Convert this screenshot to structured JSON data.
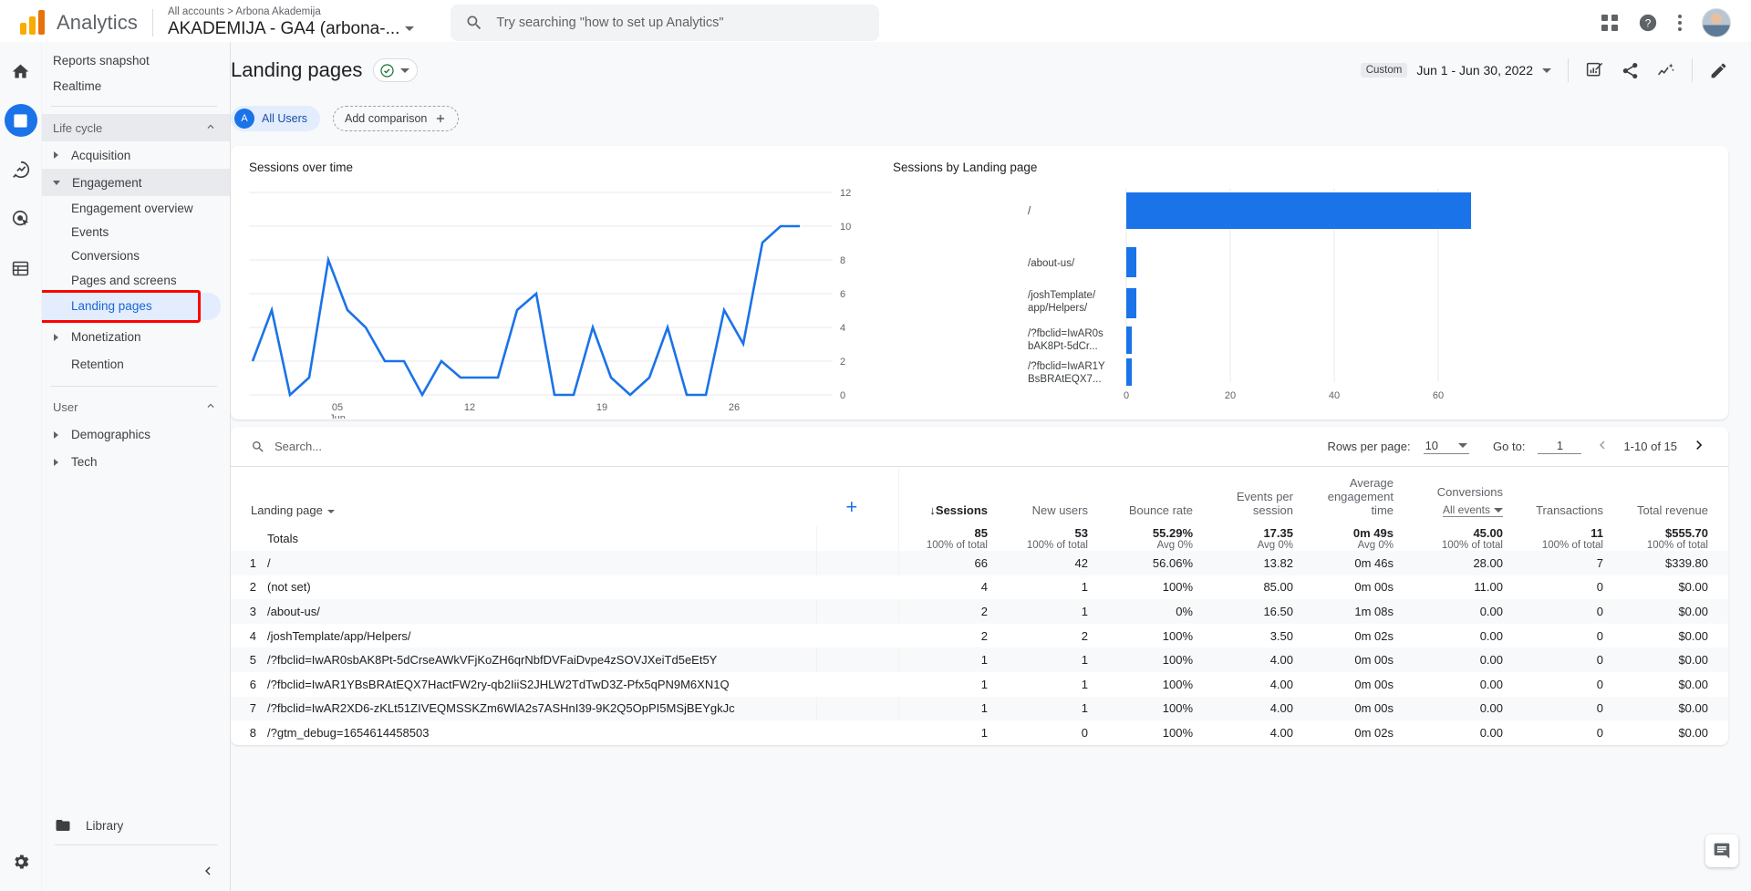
{
  "topbar": {
    "brand": "Analytics",
    "breadcrumb": "All accounts  >  Arbona Akademija",
    "property": "AKADEMIJA - GA4 (arbona-...",
    "search_placeholder": "Try searching \"how to set up Analytics\"",
    "apps_icon": "apps-grid-icon",
    "help_icon": "help-icon",
    "more_icon": "kebab-menu-icon",
    "avatar": "user-avatar"
  },
  "rail": {
    "items": [
      {
        "name": "home-icon",
        "label": "Home"
      },
      {
        "name": "reports-icon",
        "label": "Reports"
      },
      {
        "name": "explore-icon",
        "label": "Explore"
      },
      {
        "name": "advertising-icon",
        "label": "Advertising"
      },
      {
        "name": "configure-icon",
        "label": "Configure"
      }
    ],
    "settings": "settings-gear-icon"
  },
  "sidebar": {
    "top_items": [
      {
        "label": "Reports snapshot"
      },
      {
        "label": "Realtime"
      }
    ],
    "groups": [
      {
        "title": "Life cycle",
        "items": [
          {
            "label": "Acquisition",
            "expanded": false
          },
          {
            "label": "Engagement",
            "expanded": true,
            "children": [
              "Engagement overview",
              "Events",
              "Conversions",
              "Pages and screens",
              "Landing pages"
            ]
          },
          {
            "label": "Monetization",
            "expanded": false
          },
          {
            "label": "Retention",
            "expanded": null
          }
        ]
      },
      {
        "title": "User",
        "items": [
          {
            "label": "Demographics",
            "expanded": false
          },
          {
            "label": "Tech",
            "expanded": false
          }
        ]
      }
    ],
    "selected": "Landing pages",
    "library": "Library",
    "collapse_icon": "chevron-left-icon"
  },
  "page": {
    "title": "Landing pages",
    "status_icon": "check-circle-icon",
    "status_color": "#137333",
    "date_tag": "Custom",
    "date_range": "Jun 1 - Jun 30, 2022",
    "actions": [
      {
        "name": "insights-icon",
        "label": "Insights"
      },
      {
        "name": "share-icon",
        "label": "Share this report"
      },
      {
        "name": "compare-icon",
        "label": "Comparison"
      },
      {
        "name": "edit-icon",
        "label": "Edit"
      }
    ],
    "chips": {
      "all_users_initial": "A",
      "all_users": "All Users",
      "add_comparison": "Add comparison"
    }
  },
  "chart_data": [
    {
      "type": "line",
      "title": "Sessions over time",
      "xlabel": "",
      "ylabel": "",
      "ylim": [
        0,
        12
      ],
      "yticks": [
        0,
        2,
        4,
        6,
        8,
        10,
        12
      ],
      "xticks": [
        "05",
        "12",
        "19",
        "26"
      ],
      "xtick_sublabel": "Jun",
      "grid": true,
      "legend": "none",
      "series_color": "#1a73e8",
      "x": [
        "Jun 1",
        "Jun 2",
        "Jun 3",
        "Jun 4",
        "Jun 5",
        "Jun 6",
        "Jun 7",
        "Jun 8",
        "Jun 9",
        "Jun 10",
        "Jun 11",
        "Jun 12",
        "Jun 13",
        "Jun 14",
        "Jun 15",
        "Jun 16",
        "Jun 17",
        "Jun 18",
        "Jun 19",
        "Jun 20",
        "Jun 21",
        "Jun 22",
        "Jun 23",
        "Jun 24",
        "Jun 25",
        "Jun 26",
        "Jun 27",
        "Jun 28",
        "Jun 29",
        "Jun 30"
      ],
      "values": [
        2,
        5,
        0,
        1,
        8,
        5,
        4,
        2,
        2,
        0,
        2,
        1,
        1,
        1,
        5,
        6,
        0,
        0,
        4,
        1,
        0,
        1,
        4,
        0,
        0,
        5,
        3,
        9,
        10,
        10
      ]
    },
    {
      "type": "bar",
      "orientation": "horizontal",
      "title": "Sessions by Landing page",
      "xlim": [
        0,
        66
      ],
      "xticks": [
        0,
        20,
        40,
        60
      ],
      "grid": true,
      "bar_color": "#1a73e8",
      "categories": [
        "/",
        "/about-us/",
        "/joshTemplate/\napp/Helpers/",
        "/?fbclid=IwAR0s\nbAK8Pt-5dCr...",
        "/?fbclid=IwAR1Y\nBsBRAtEQX7..."
      ],
      "values": [
        66,
        2,
        2,
        1,
        1
      ]
    }
  ],
  "table": {
    "search_placeholder": "Search...",
    "pagination": {
      "rows_label": "Rows per page:",
      "rows_value": "10",
      "goto_label": "Go to:",
      "goto_value": "1",
      "range": "1-10 of 15",
      "prev_icon": "chevron-left-icon",
      "next_icon": "chevron-right-icon"
    },
    "dimension_header": "Landing page",
    "add_dimension_icon": "plus-icon",
    "columns": [
      {
        "label": "Sessions",
        "sorted": true,
        "sort_icon": "arrow-down"
      },
      {
        "label": "New users"
      },
      {
        "label": "Bounce rate"
      },
      {
        "label": "Events per session"
      },
      {
        "label": "Average engagement time"
      },
      {
        "label": "Conversions",
        "sub": "All events"
      },
      {
        "label": "Transactions"
      },
      {
        "label": "Total revenue"
      }
    ],
    "totals": {
      "label": "Totals",
      "values": [
        "85",
        "53",
        "55.29%",
        "17.35",
        "0m 49s",
        "45.00",
        "11",
        "$555.70"
      ],
      "subs": [
        "100% of total",
        "100% of total",
        "Avg 0%",
        "Avg 0%",
        "Avg 0%",
        "100% of total",
        "100% of total",
        "100% of total"
      ]
    },
    "rows": [
      {
        "idx": "1",
        "dim": "/",
        "vals": [
          "66",
          "42",
          "56.06%",
          "13.82",
          "0m 46s",
          "28.00",
          "7",
          "$339.80"
        ]
      },
      {
        "idx": "2",
        "dim": "(not set)",
        "vals": [
          "4",
          "1",
          "100%",
          "85.00",
          "0m 00s",
          "11.00",
          "0",
          "$0.00"
        ]
      },
      {
        "idx": "3",
        "dim": "/about-us/",
        "vals": [
          "2",
          "1",
          "0%",
          "16.50",
          "1m 08s",
          "0.00",
          "0",
          "$0.00"
        ]
      },
      {
        "idx": "4",
        "dim": "/joshTemplate/app/Helpers/",
        "vals": [
          "2",
          "2",
          "100%",
          "3.50",
          "0m 02s",
          "0.00",
          "0",
          "$0.00"
        ]
      },
      {
        "idx": "5",
        "dim": "/?fbclid=IwAR0sbAK8Pt-5dCrseAWkVFjKoZH6qrNbfDVFaiDvpe4zSOVJXeiTd5eEt5Y",
        "vals": [
          "1",
          "1",
          "100%",
          "4.00",
          "0m 00s",
          "0.00",
          "0",
          "$0.00"
        ]
      },
      {
        "idx": "6",
        "dim": "/?fbclid=IwAR1YBsBRAtEQX7HactFW2ry-qb2IiiS2JHLW2TdTwD3Z-Pfx5qPN9M6XN1Q",
        "vals": [
          "1",
          "1",
          "100%",
          "4.00",
          "0m 00s",
          "0.00",
          "0",
          "$0.00"
        ]
      },
      {
        "idx": "7",
        "dim": "/?fbclid=IwAR2XD6-zKLt51ZIVEQMSSKZm6WlA2s7ASHnI39-9K2Q5OpPI5MSjBEYgkJc",
        "vals": [
          "1",
          "1",
          "100%",
          "4.00",
          "0m 00s",
          "0.00",
          "0",
          "$0.00"
        ]
      },
      {
        "idx": "8",
        "dim": "/?gtm_debug=1654614458503",
        "vals": [
          "1",
          "0",
          "100%",
          "4.00",
          "0m 02s",
          "0.00",
          "0",
          "$0.00"
        ]
      }
    ]
  },
  "feedback_icon": "feedback-icon"
}
